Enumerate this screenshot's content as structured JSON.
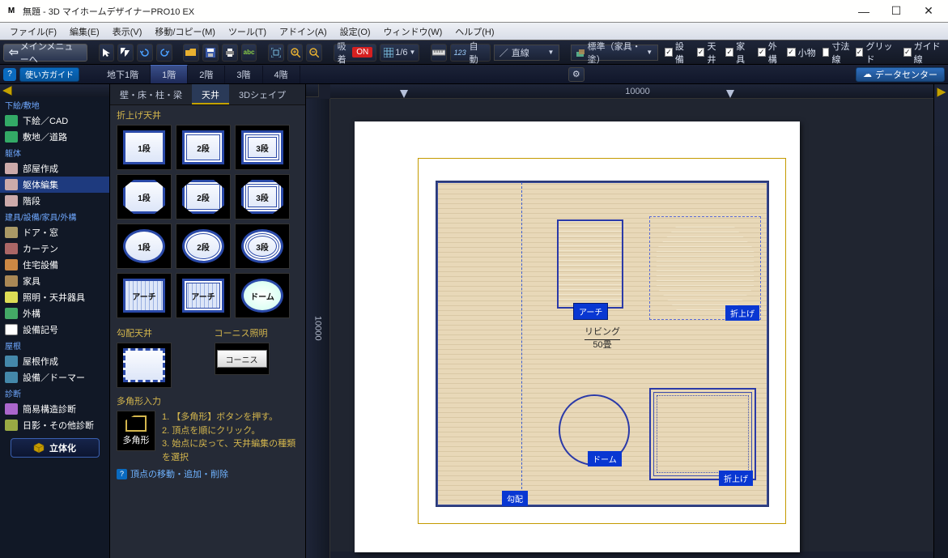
{
  "title": "無題 - 3D マイホームデザイナーPRO10 EX",
  "menubar": [
    "ファイル(F)",
    "編集(E)",
    "表示(V)",
    "移動/コピー(M)",
    "ツール(T)",
    "アドイン(A)",
    "設定(O)",
    "ウィンドウ(W)",
    "ヘルプ(H)"
  ],
  "toolbar": {
    "main_menu": "メインメニューへ",
    "snap_label": "吸着",
    "snap_state": "ON",
    "grid_frac": "1/6",
    "auto_label": "自動",
    "line_label": "直線",
    "layer_label": "標準（家具・塗）",
    "checks": {
      "equip": {
        "label": "設備",
        "checked": true
      },
      "furn": {
        "label": "家具",
        "checked": true
      },
      "small": {
        "label": "小物",
        "checked": true
      },
      "grid": {
        "label": "グリッド",
        "checked": true
      },
      "ceil": {
        "label": "天井",
        "checked": true
      },
      "ext": {
        "label": "外構",
        "checked": true
      },
      "dim": {
        "label": "寸法線",
        "checked": false
      },
      "guide": {
        "label": "ガイド線",
        "checked": true
      }
    },
    "measure_icon": "📏"
  },
  "floorstrip": {
    "guide_btn": "使い方ガイド",
    "floors": [
      "地下1階",
      "1階",
      "2階",
      "3階",
      "4階"
    ],
    "active_floor": 1,
    "datacenter": "データセンター"
  },
  "left": {
    "sections": {
      "sketch": {
        "hdr": "下絵/敷地",
        "items": [
          "下絵／CAD",
          "敷地／道路"
        ]
      },
      "body": {
        "hdr": "躯体",
        "items": [
          "部屋作成",
          "躯体編集",
          "階段"
        ]
      },
      "fix": {
        "hdr": "建具/設備/家具/外構",
        "items": [
          "ドア・窓",
          "カーテン",
          "住宅設備",
          "家具",
          "照明・天井器具",
          "外構",
          "設備記号"
        ]
      },
      "roof": {
        "hdr": "屋根",
        "items": [
          "屋根作成",
          "設備／ドーマー"
        ]
      },
      "diag": {
        "hdr": "診断",
        "items": [
          "簡易構造診断",
          "日影・その他診断"
        ]
      }
    },
    "fab": "立体化"
  },
  "mid": {
    "tabs": [
      "壁・床・柱・梁",
      "天井",
      "3Dシェイプ"
    ],
    "active_tab": 1,
    "sec1": "折上げ天井",
    "tiles": [
      "1段",
      "2段",
      "3段",
      "1段",
      "2段",
      "3段",
      "1段",
      "2段",
      "3段",
      "アーチ",
      "アーチ",
      "ドーム"
    ],
    "sec2a": "勾配天井",
    "sec2b": "コーニス照明",
    "cove_btn": "コーニス",
    "sec3": "多角形入力",
    "poly_label": "多角形",
    "steps": [
      "1. 【多角形】ボタンを押す。",
      "2. 頂点を順にクリック。",
      "3. 始点に戻って、天井編集の種類を選択"
    ],
    "help_link": "頂点の移動・追加・削除"
  },
  "canvas": {
    "h_ruler_value": "10000",
    "v_ruler_value": "10000",
    "room_name": "リビング",
    "room_size": "50畳",
    "tags": {
      "arch": "アーチ",
      "fold": "折上げ",
      "dome": "ドーム",
      "fold2": "折上げ",
      "slope": "勾配"
    }
  },
  "icons": {
    "app": "M",
    "gear": "⚙",
    "triangle": "▶",
    "cloud": "☁"
  }
}
